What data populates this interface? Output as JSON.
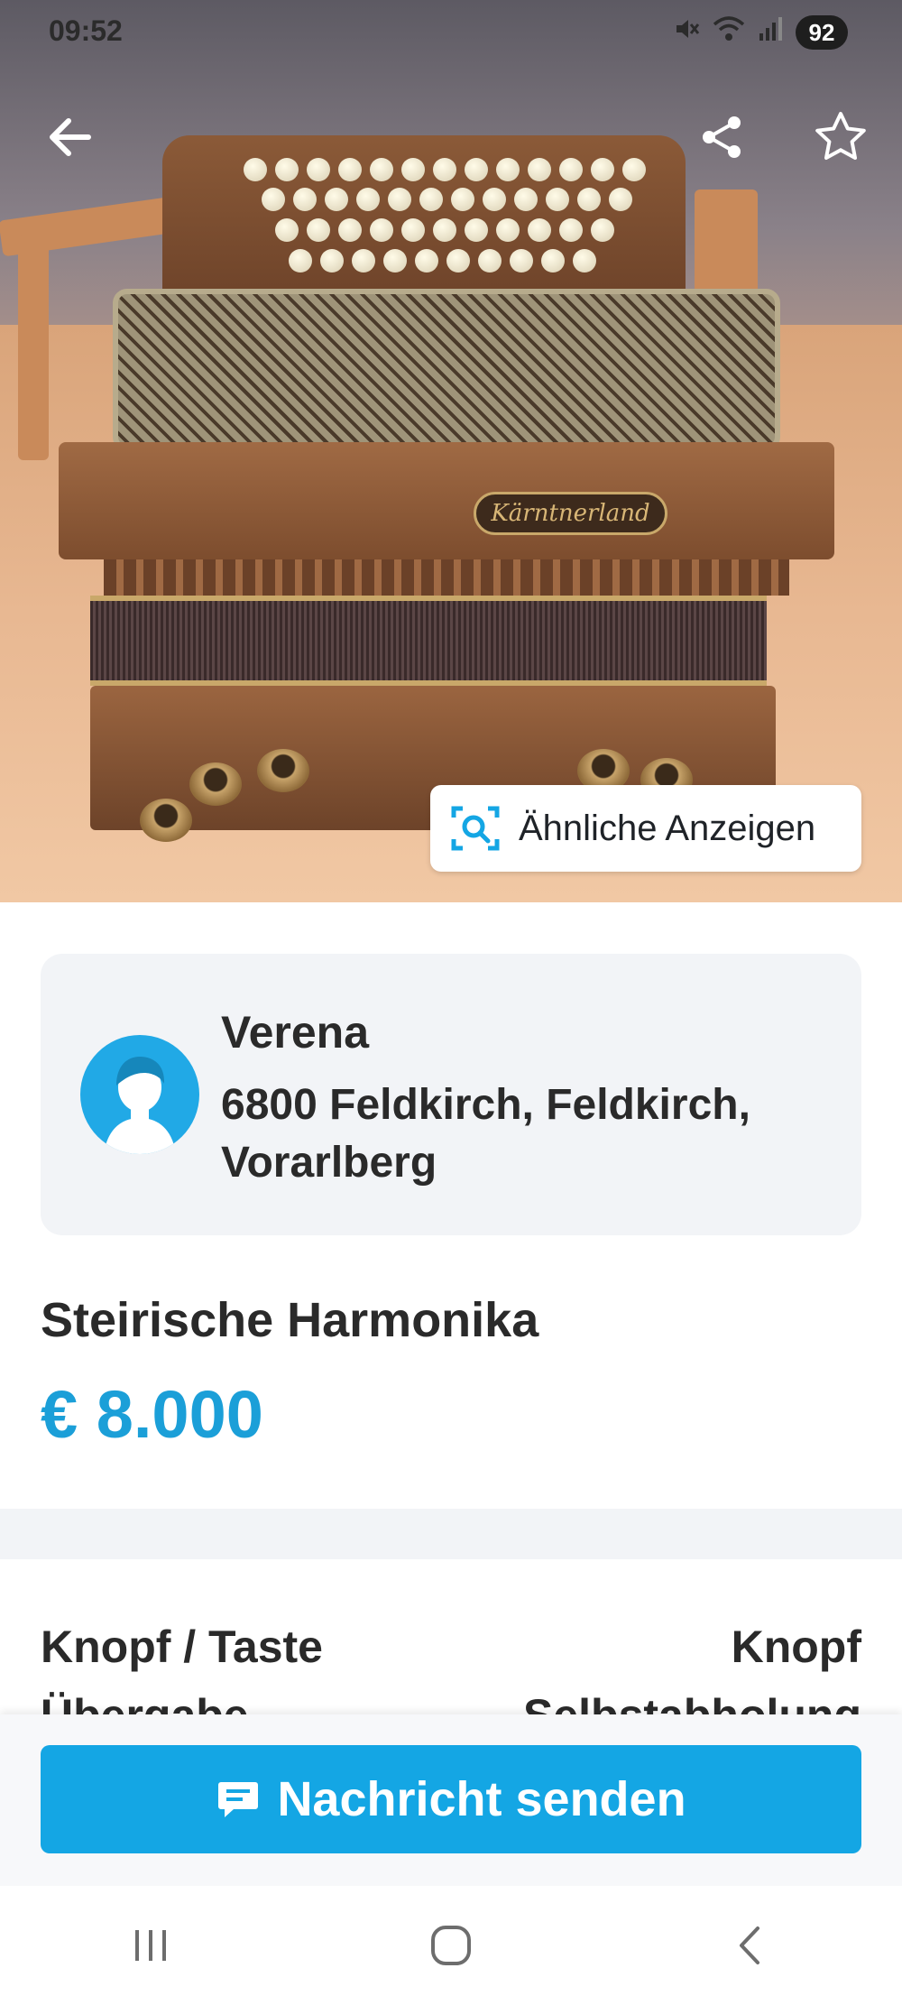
{
  "status_bar": {
    "time": "09:52",
    "battery": "92",
    "icons": [
      "mute-icon",
      "wifi-icon",
      "signal-icon",
      "battery-icon"
    ]
  },
  "hero": {
    "back_icon": "arrow-left-icon",
    "share_icon": "share-icon",
    "favorite_icon": "star-icon",
    "brand_plate": "Kärntnerland",
    "similar_button": {
      "icon": "image-search-icon",
      "label": "Ähnliche Anzeigen"
    }
  },
  "seller": {
    "avatar_icon": "user-avatar-icon",
    "name": "Verena",
    "location": "6800 Feldkirch, Feldkirch, Vorarlberg"
  },
  "listing": {
    "title": "Steirische Harmonika",
    "price": "€ 8.000"
  },
  "attributes": [
    {
      "label": "Knopf / Taste",
      "value": "Knopf"
    },
    {
      "label": "Übergabe",
      "value": "Selbstabholung"
    }
  ],
  "cta": {
    "icon": "message-icon",
    "label": "Nachricht senden"
  },
  "colors": {
    "accent": "#14a6e4",
    "price": "#1b9fd8",
    "card_bg": "#f2f4f7",
    "text": "#2a2a2a"
  },
  "nav": {
    "icons": [
      "recent-apps-icon",
      "home-icon",
      "back-icon"
    ]
  }
}
